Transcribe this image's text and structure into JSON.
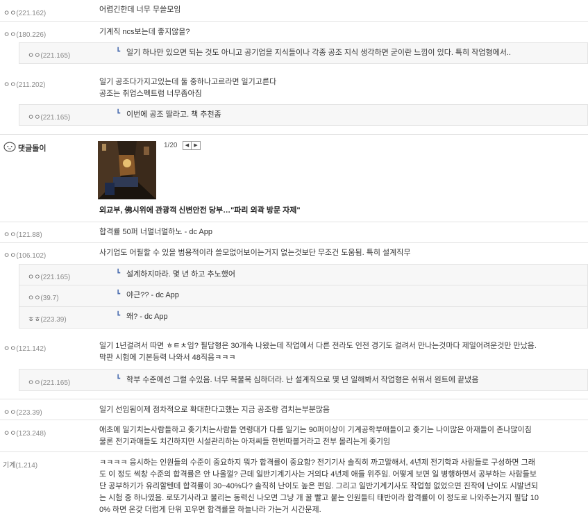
{
  "comments": [
    {
      "nick": "ㅇㅇ",
      "ip": "(221.162)",
      "text": "어렵긴한데 너무 무쓸모임"
    },
    {
      "nick": "ㅇㅇ",
      "ip": "(180.226)",
      "text": "기계직 ncs보는데 좋지않을?"
    },
    {
      "nick": "ㅇㅇ",
      "ip": "(221.165)",
      "text": "일기 하나만 있으면 되는 것도 아니고 공기업을 지식들이나 각종 공조 지식 생각하면 굳이란 느낌이 있다. 특히 작업형에서.."
    },
    {
      "nick": "ㅇㅇ",
      "ip": "(211.202)",
      "lines": [
        "일기 공조다가지고있는데 둘 중하나고르라면 일기고른다",
        "공조는 취업스펙트럼 너무좁아짐"
      ]
    },
    {
      "nick": "ㅇㅇ",
      "ip": "(221.165)",
      "text": "이번에 공조 딸라고. 책 추천좀"
    },
    {
      "nick": "ㅇㅇ",
      "ip": "(121.88)",
      "text": "합격률 50퍼 너멀너멀하노 - dc App"
    },
    {
      "nick": "ㅇㅇ",
      "ip": "(106.102)",
      "text": "사기업도 어필할 수 있을 범용적이라 쓸모없어보이는거지 없는것보단 무조건 도움됨. 특히 설계직무"
    },
    {
      "nick": "ㅇㅇ",
      "ip": "(221.165)",
      "text": "설계하지마라. 몇 년 하고 추노했어"
    },
    {
      "nick": "ㅇㅇ",
      "ip": "(39.7)",
      "text": "야근?? - dc App"
    },
    {
      "nick": "ㅎㅎ",
      "ip": "(223.39)",
      "text": "왜? - dc App"
    },
    {
      "nick": "ㅇㅇ",
      "ip": "(121.142)",
      "lines": [
        "일기 1년걸려서 따면 ㅎㅌㅊ임? 필답형은 30개속 나왔는데 작업에서 다른 전라도 인전 경기도 걸려서 만나는것마다 제일어려운것만 만났음.",
        "막판 시험에 기본등력 나와서 48직음ㅋㅋㅋ"
      ]
    },
    {
      "nick": "ㅇㅇ",
      "ip": "(221.165)",
      "text": "학부 수준에선 그럴 수있음. 너무 복불복 심하더라. 난 설계직으로 몇 년 일해봐서 작업형은 쉬워서 원트에 끝냈음"
    },
    {
      "nick": "ㅇㅇ",
      "ip": "(223.39)",
      "text": "일기 선임됨이제 점차적으로 확대한다고했는 지금 공조랑 겹치는부분많음"
    },
    {
      "nick": "ㅇㅇ",
      "ip": "(123.248)",
      "lines": [
        "애초에 일기치는사람들하고 좆기치는사람들 연령대가 다름 일기는 90퍼이상이 기계공학부애들이고 좆기는 나이많은 아재들이 존나많이침",
        "물론 전기과애들도 치긴하지만 시설관리하는 아저씨들 한번따볼거라고 전부 몰리는게 좆기임"
      ]
    },
    {
      "nick": "기계",
      "ip": "(1.214)",
      "lines": [
        "ㅋㅋㅋㅋ 응시하는 인원들의 수준이 중요하지 뭐가 합격률이 중요함? 전기기사 솔직히 까고말해서, 4년제 전기학과 사람들로 구성하면 그래",
        "도 이 정도 썩창 수준의 합격률은 안 나올껄? 근데 일반기계기사는 거의다 4년제 애들 위주임. 어떻게 보면 일 병행하면서 공부하는 사람들보",
        "단 공부하기가 유리할텐데 합격률이 30~40%다? 솔직히 난이도 높은 편임. 그리고 일반기계기사도 작업형 없었으면 진작에 난이도 시발년되",
        "는 시험 중 하나였음. 로또기사라고 불리는 동력신 나오면 그냥 개 꿀 빨고 붙는 인원들티 태반이라 합격률이 이 정도로 나와주는거지 필답 10",
        "0% 하면 온갖 더럽게 단위 꼬우면 합격률을 하늘나라 가는거 시간문제."
      ]
    }
  ],
  "bot": {
    "name": "댓글돌이",
    "pager": "1/20",
    "prev": "◀",
    "next": "▶",
    "headline": "외교부, 佛시위에 관광객 신변안전 당부…\"파리 외곽 방문 자제\""
  },
  "reply_arrow": "┗"
}
